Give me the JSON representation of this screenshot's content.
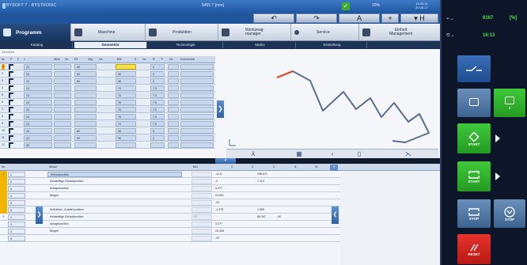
{
  "titlebar": {
    "brand": "BYSOFT 7 - BYSTRONIC",
    "center": "5455    T [mm]",
    "status_pct": "20%",
    "clock": "15:05:11\n20.08.17",
    "ok_glyph": "✓"
  },
  "quickbar": {
    "buttons": [
      "↶",
      "↷",
      "A",
      "+",
      "▾ H"
    ]
  },
  "mainmenu": {
    "items": [
      {
        "label": "Programm",
        "active": true
      },
      {
        "label": "Maschine",
        "active": false
      },
      {
        "label": "Produktion",
        "active": false
      },
      {
        "label": "Werkzeug-\nmanager",
        "active": false
      },
      {
        "label": "Service",
        "active": false
      },
      {
        "label": "Einheit\nManagement",
        "active": false
      }
    ]
  },
  "subtabs": {
    "items": [
      {
        "label": "Katalog",
        "active": false
      },
      {
        "label": "Geometrie",
        "active": true
      },
      {
        "label": "Technologie",
        "active": false
      },
      {
        "label": "Matrix",
        "active": false
      },
      {
        "label": "Einstellung",
        "active": false
      }
    ]
  },
  "upper_grid": {
    "title": "Geometrie",
    "headers": [
      "Nr.",
      "P",
      "Σ",
      "L",
      "Wink",
      "Ho",
      "Eff.",
      "Seg",
      "Ho",
      "BW",
      "S",
      "Ho",
      "R",
      "Ti",
      "Ho",
      "Kommentar"
    ],
    "rows": [
      {
        "nr": "1",
        "l": "24",
        "bw": "90",
        "s": "",
        "r": "0"
      },
      {
        "nr": "2",
        "l": "24",
        "bw": "90",
        "s": "90",
        "r": "0"
      },
      {
        "nr": "3",
        "l": "24",
        "bw": "80",
        "s": "80",
        "r": "0"
      },
      {
        "nr": "4",
        "l": "24",
        "bw": "",
        "s": "70",
        "r": "7.5"
      },
      {
        "nr": "5",
        "l": "24",
        "bw": "",
        "s": "70",
        "r": "7.5"
      },
      {
        "nr": "6",
        "l": "24",
        "bw": "",
        "s": "70",
        "r": "7.5"
      },
      {
        "nr": "7",
        "l": "24",
        "bw": "",
        "s": "70",
        "r": "7.5"
      },
      {
        "nr": "8",
        "l": "24",
        "bw": "",
        "s": "70",
        "r": "7.5"
      },
      {
        "nr": "9",
        "l": "24",
        "bw": "",
        "s": "70",
        "r": "7.5"
      },
      {
        "nr": "10",
        "l": "24",
        "bw": "60",
        "s": "90",
        "r": "0"
      },
      {
        "nr": "11",
        "l": "44",
        "bw": "90",
        "s": "90",
        "r": "0"
      },
      {
        "nr": "12",
        "l": "36",
        "bw": "",
        "s": "",
        "r": ""
      }
    ]
  },
  "expander_right": "❯",
  "viewbar": {
    "buttons": [
      "⅄",
      "▦",
      "‹",
      "▯",
      "⋋"
    ]
  },
  "collapse_label": "▾",
  "lower_grid": {
    "headers": [
      "Nr.",
      "Ablauf",
      "B/U",
      "X",
      "Z",
      "C",
      "A",
      "W"
    ],
    "rows": [
      {
        "nr": "1",
        "idx": "1",
        "text": "Einlaufposition",
        "sel": true,
        "b": "",
        "x": "-11.6",
        "z": "158.671",
        "c": "",
        "highlight": true
      },
      {
        "nr": "",
        "idx": "2",
        "text": "Axialseitige Einlaufposition",
        "sel": false,
        "b": "",
        "x": "-2",
        "z": "7.113",
        "c": "",
        "highlight": true
      },
      {
        "nr": "",
        "idx": "3",
        "text": "Anlageposition",
        "sel": false,
        "b": "",
        "x": "3.277",
        "z": "",
        "c": "",
        "highlight": true
      },
      {
        "nr": "",
        "idx": "4",
        "text": "Biegen",
        "sel": false,
        "b": "",
        "x": "24.651",
        "z": "",
        "c": "",
        "highlight": true
      },
      {
        "nr": "",
        "idx": "5",
        "text": "",
        "sel": false,
        "b": "",
        "x": "-22",
        "z": "",
        "c": "",
        "highlight": true
      },
      {
        "nr": "",
        "idx": "6",
        "text": "Aufhaltern, Ausfahrposition",
        "sel": false,
        "b": "",
        "x": "-1.978",
        "z": "1.585",
        "c": "",
        "highlight": true
      },
      {
        "nr": "2",
        "idx": "1",
        "text": "Axialseitige Einlaufposition",
        "sel": false,
        "b": "-65",
        "x": "",
        "z": "88.347",
        "c": "-90",
        "highlight": false
      },
      {
        "nr": "",
        "idx": "2",
        "text": "Anlageposition",
        "sel": false,
        "b": "",
        "x": "3.277",
        "z": "",
        "c": "",
        "highlight": false
      },
      {
        "nr": "",
        "idx": "3",
        "text": "Biegen",
        "sel": false,
        "b": "",
        "x": "24.408",
        "z": "",
        "c": "",
        "highlight": false
      },
      {
        "nr": "",
        "idx": "4",
        "text": "",
        "sel": false,
        "b": "",
        "x": "-22",
        "z": "",
        "c": "",
        "highlight": false
      }
    ],
    "add_glyph": "+",
    "left_expander": "❯",
    "right_expander": "❮"
  },
  "rightpanel": {
    "row1_label": "⌁→",
    "row1_value": "9167",
    "row1_unit": "[%]",
    "row2_label": "⏲→",
    "row2_value": "16:13",
    "start_label_1": "START",
    "start_label_2": "START",
    "stop_label_1": "STOP",
    "stop_label_2": "STOP",
    "reset_label": "RESET",
    "small_btn_label": "1"
  },
  "colors": {
    "accent_blue": "#2d62a8",
    "ok_green": "#3fae2a",
    "active_green": "#2fb42c",
    "reset_red": "#d3251f",
    "highlight_yellow": "#f2b600"
  }
}
